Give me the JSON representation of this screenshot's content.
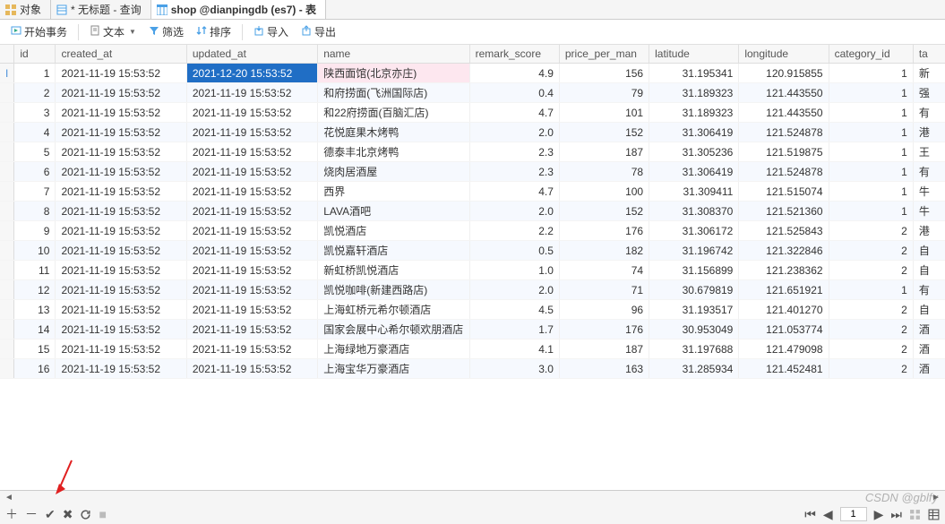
{
  "tabs": [
    {
      "label": "对象",
      "icon": "grid"
    },
    {
      "label": "* 无标题 - 查询",
      "icon": "sheet"
    },
    {
      "label": "shop @dianpingdb (es7) - 表",
      "icon": "table",
      "active": true
    }
  ],
  "toolbar": {
    "begin_txn": "开始事务",
    "text": "文本",
    "filter": "筛选",
    "sort": "排序",
    "import": "导入",
    "export": "导出"
  },
  "columns": [
    "id",
    "created_at",
    "updated_at",
    "name",
    "remark_score",
    "price_per_man",
    "latitude",
    "longitude",
    "category_id",
    "ta"
  ],
  "rows": [
    {
      "id": 1,
      "created_at": "2021-11-19 15:53:52",
      "updated_at": "2021-12-20 15:53:52",
      "name": "陕西面馆(北京亦庄)",
      "remark_score": "4.9",
      "price_per_man": 156,
      "latitude": "31.195341",
      "longitude": "120.915855",
      "category_id": 1,
      "ta": "新",
      "selected": true
    },
    {
      "id": 2,
      "created_at": "2021-11-19 15:53:52",
      "updated_at": "2021-11-19 15:53:52",
      "name": "和府捞面(飞洲国际店)",
      "remark_score": "0.4",
      "price_per_man": 79,
      "latitude": "31.189323",
      "longitude": "121.443550",
      "category_id": 1,
      "ta": "强"
    },
    {
      "id": 3,
      "created_at": "2021-11-19 15:53:52",
      "updated_at": "2021-11-19 15:53:52",
      "name": "和22府捞面(百脑汇店)",
      "remark_score": "4.7",
      "price_per_man": 101,
      "latitude": "31.189323",
      "longitude": "121.443550",
      "category_id": 1,
      "ta": "有"
    },
    {
      "id": 4,
      "created_at": "2021-11-19 15:53:52",
      "updated_at": "2021-11-19 15:53:52",
      "name": "花悦庭果木烤鸭",
      "remark_score": "2.0",
      "price_per_man": 152,
      "latitude": "31.306419",
      "longitude": "121.524878",
      "category_id": 1,
      "ta": "港"
    },
    {
      "id": 5,
      "created_at": "2021-11-19 15:53:52",
      "updated_at": "2021-11-19 15:53:52",
      "name": "德泰丰北京烤鸭",
      "remark_score": "2.3",
      "price_per_man": 187,
      "latitude": "31.305236",
      "longitude": "121.519875",
      "category_id": 1,
      "ta": "王"
    },
    {
      "id": 6,
      "created_at": "2021-11-19 15:53:52",
      "updated_at": "2021-11-19 15:53:52",
      "name": "烧肉居酒屋",
      "remark_score": "2.3",
      "price_per_man": 78,
      "latitude": "31.306419",
      "longitude": "121.524878",
      "category_id": 1,
      "ta": "有"
    },
    {
      "id": 7,
      "created_at": "2021-11-19 15:53:52",
      "updated_at": "2021-11-19 15:53:52",
      "name": "西界",
      "remark_score": "4.7",
      "price_per_man": 100,
      "latitude": "31.309411",
      "longitude": "121.515074",
      "category_id": 1,
      "ta": "牛"
    },
    {
      "id": 8,
      "created_at": "2021-11-19 15:53:52",
      "updated_at": "2021-11-19 15:53:52",
      "name": "LAVA酒吧",
      "remark_score": "2.0",
      "price_per_man": 152,
      "latitude": "31.308370",
      "longitude": "121.521360",
      "category_id": 1,
      "ta": "牛"
    },
    {
      "id": 9,
      "created_at": "2021-11-19 15:53:52",
      "updated_at": "2021-11-19 15:53:52",
      "name": "凯悦酒店",
      "remark_score": "2.2",
      "price_per_man": 176,
      "latitude": "31.306172",
      "longitude": "121.525843",
      "category_id": 2,
      "ta": "港"
    },
    {
      "id": 10,
      "created_at": "2021-11-19 15:53:52",
      "updated_at": "2021-11-19 15:53:52",
      "name": "凯悦嘉轩酒店",
      "remark_score": "0.5",
      "price_per_man": 182,
      "latitude": "31.196742",
      "longitude": "121.322846",
      "category_id": 2,
      "ta": "自"
    },
    {
      "id": 11,
      "created_at": "2021-11-19 15:53:52",
      "updated_at": "2021-11-19 15:53:52",
      "name": "新虹桥凯悦酒店",
      "remark_score": "1.0",
      "price_per_man": 74,
      "latitude": "31.156899",
      "longitude": "121.238362",
      "category_id": 2,
      "ta": "自"
    },
    {
      "id": 12,
      "created_at": "2021-11-19 15:53:52",
      "updated_at": "2021-11-19 15:53:52",
      "name": "凯悦咖啡(新建西路店)",
      "remark_score": "2.0",
      "price_per_man": 71,
      "latitude": "30.679819",
      "longitude": "121.651921",
      "category_id": 1,
      "ta": "有"
    },
    {
      "id": 13,
      "created_at": "2021-11-19 15:53:52",
      "updated_at": "2021-11-19 15:53:52",
      "name": "上海虹桥元希尔顿酒店",
      "remark_score": "4.5",
      "price_per_man": 96,
      "latitude": "31.193517",
      "longitude": "121.401270",
      "category_id": 2,
      "ta": "自"
    },
    {
      "id": 14,
      "created_at": "2021-11-19 15:53:52",
      "updated_at": "2021-11-19 15:53:52",
      "name": "国家会展中心希尔顿欢朋酒店",
      "remark_score": "1.7",
      "price_per_man": 176,
      "latitude": "30.953049",
      "longitude": "121.053774",
      "category_id": 2,
      "ta": "酒"
    },
    {
      "id": 15,
      "created_at": "2021-11-19 15:53:52",
      "updated_at": "2021-11-19 15:53:52",
      "name": "上海绿地万豪酒店",
      "remark_score": "4.1",
      "price_per_man": 187,
      "latitude": "31.197688",
      "longitude": "121.479098",
      "category_id": 2,
      "ta": "酒"
    },
    {
      "id": 16,
      "created_at": "2021-11-19 15:53:52",
      "updated_at": "2021-11-19 15:53:52",
      "name": "上海宝华万豪酒店",
      "remark_score": "3.0",
      "price_per_man": 163,
      "latitude": "31.285934",
      "longitude": "121.452481",
      "category_id": 2,
      "ta": "酒"
    }
  ],
  "pager": {
    "page": "1"
  },
  "watermark": "CSDN @gblfy"
}
